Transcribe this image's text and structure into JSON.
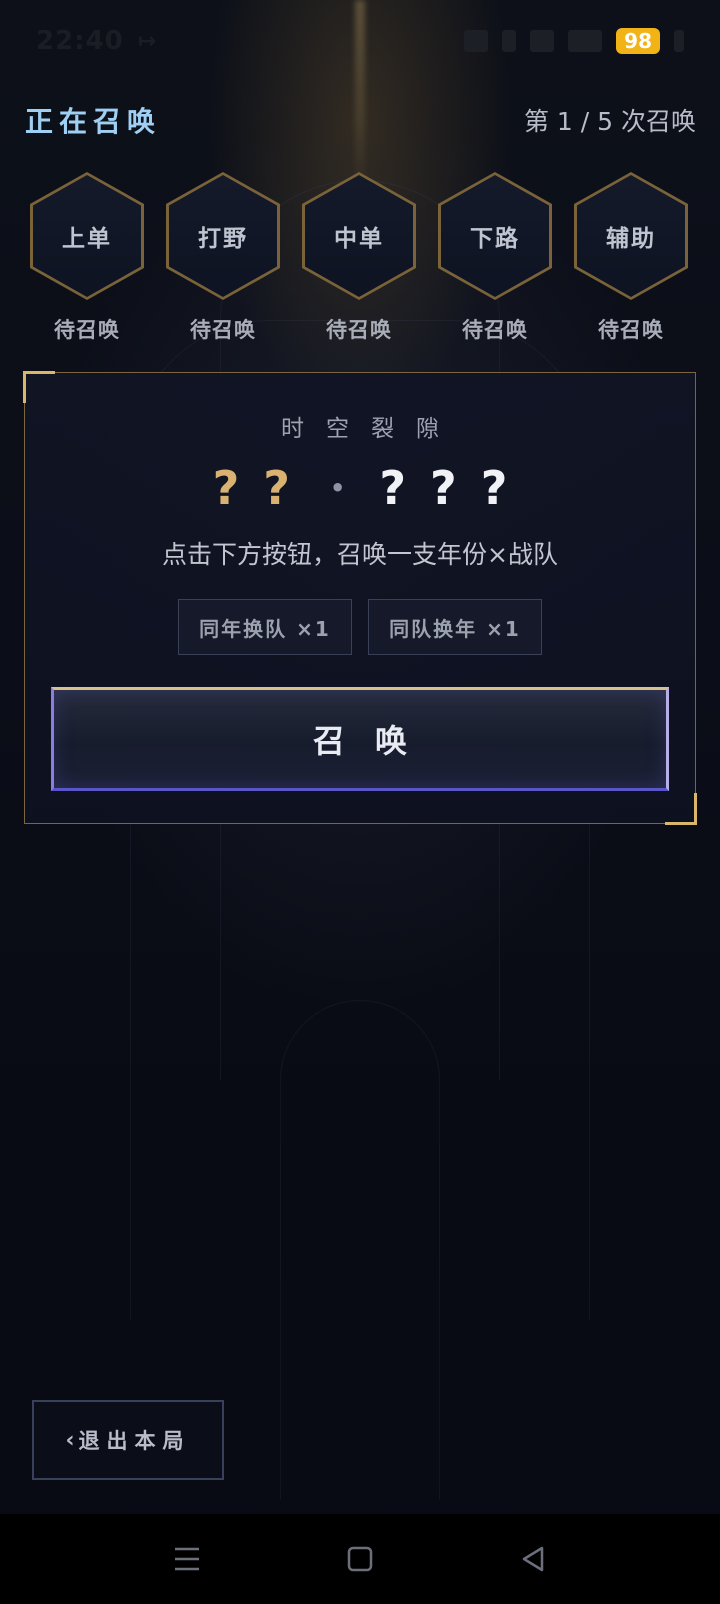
{
  "status_bar": {
    "time": "22:40",
    "arrow": "↦",
    "battery": "98"
  },
  "header": {
    "title": "正在召唤",
    "progress": "第 1 / 5 次召唤"
  },
  "slots": [
    {
      "role": "上单",
      "status": "待召唤"
    },
    {
      "role": "打野",
      "status": "待召唤"
    },
    {
      "role": "中单",
      "status": "待召唤"
    },
    {
      "role": "下路",
      "status": "待召唤"
    },
    {
      "role": "辅助",
      "status": "待召唤"
    }
  ],
  "card": {
    "subtitle": "时空裂隙",
    "mark1": "?",
    "mark2": "?",
    "dot": "•",
    "mark3": "?",
    "mark4": "?",
    "mark5": "?",
    "description": "点击下方按钮，召唤一支年份×战队",
    "chip1": "同年换队 ×1",
    "chip2": "同队换年 ×1",
    "summon_label": "召唤"
  },
  "exit": {
    "chevron": "‹",
    "label": "退出本局"
  },
  "colors": {
    "accent_blue": "#9fd0f4",
    "gold": "#d9b272",
    "card_border": "#7a6640"
  }
}
